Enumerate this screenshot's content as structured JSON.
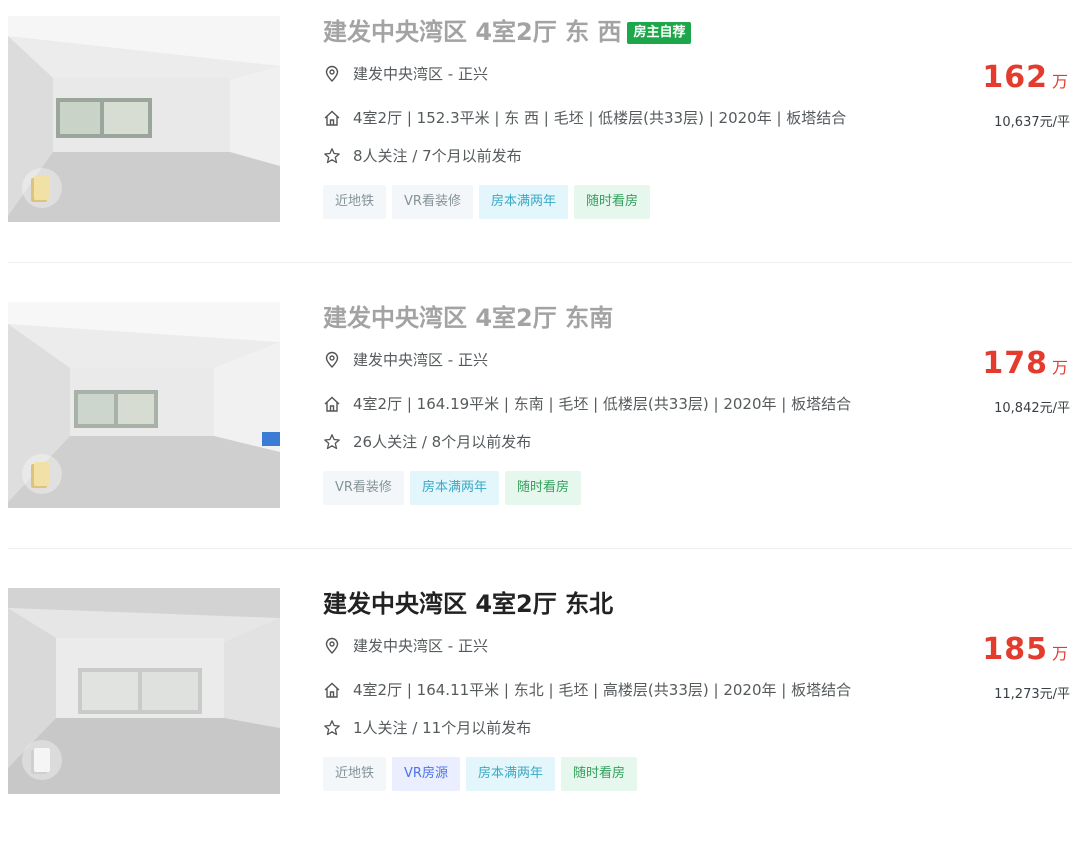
{
  "listings": [
    {
      "title": "建发中央湾区 4室2厅 东 西",
      "owner_badge": "房主自荐",
      "address": "建发中央湾区 - 正兴",
      "info": "4室2厅 | 152.3平米 | 东 西 | 毛坯 | 低楼层(共33层) | 2020年 | 板塔结合",
      "follow": "8人关注 / 7个月以前发布",
      "tags": [
        "近地铁",
        "VR看装修",
        "房本满两年",
        "随时看房"
      ],
      "price": "162",
      "price_unit": "万",
      "unit_price": "10,637元/平"
    },
    {
      "title": "建发中央湾区 4室2厅 东南",
      "address": "建发中央湾区 - 正兴",
      "info": "4室2厅 | 164.19平米 | 东南 | 毛坯 | 低楼层(共33层) | 2020年 | 板塔结合",
      "follow": "26人关注 / 8个月以前发布",
      "tags": [
        "VR看装修",
        "房本满两年",
        "随时看房"
      ],
      "price": "178",
      "price_unit": "万",
      "unit_price": "10,842元/平"
    },
    {
      "title": "建发中央湾区 4室2厅 东北",
      "address": "建发中央湾区 - 正兴",
      "info": "4室2厅 | 164.11平米 | 东北 | 毛坯 | 高楼层(共33层) | 2020年 | 板塔结合",
      "follow": "1人关注 / 11个月以前发布",
      "tags": [
        "近地铁",
        "VR房源",
        "房本满两年",
        "随时看房"
      ],
      "price": "185",
      "price_unit": "万",
      "unit_price": "11,273元/平"
    }
  ],
  "icons": {
    "address": "location-pin-icon",
    "info": "house-icon",
    "follow": "star-icon",
    "vr": "vr-door-icon"
  },
  "colors": {
    "price": "#e33c2e",
    "owner_badge": "#1ea64a",
    "tag_gray": "#859399",
    "tag_cyan": "#3ba9c6",
    "tag_green": "#33a05c",
    "tag_blue": "#4b74e5"
  }
}
